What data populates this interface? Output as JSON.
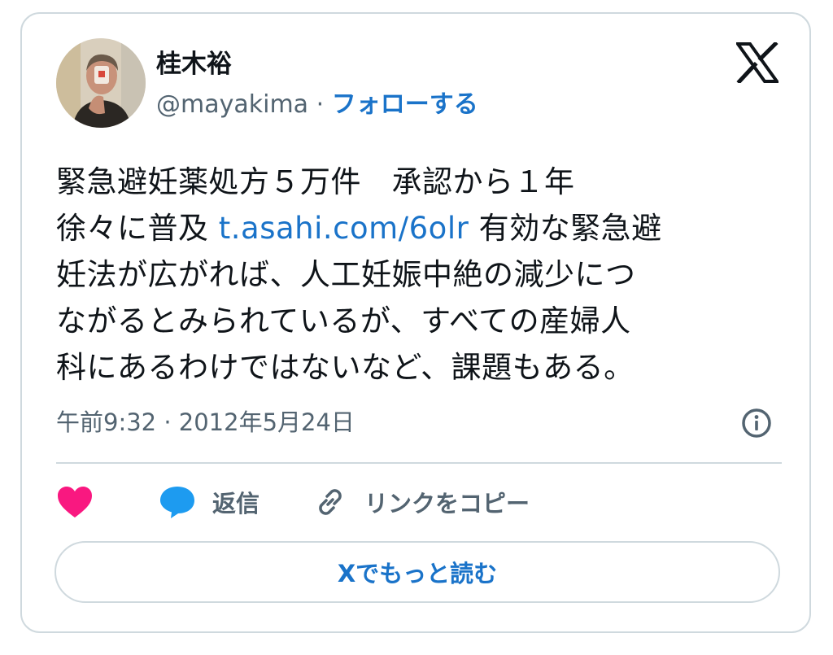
{
  "author": {
    "name": "桂木裕",
    "handle": "@mayakima",
    "separator": "·",
    "follow_label": "フォローする"
  },
  "tweet": {
    "line1": "緊急避妊薬処方５万件　承認から１年",
    "line2_before_link": "徐々に普及 ",
    "link": "t.asahi.com/6olr",
    "line2_after_link": " 有効な緊急避",
    "line3": "妊法が広がれば、人工妊娠中絶の減少につ",
    "line4": "ながるとみられているが、すべての産婦人",
    "line5": "科にあるわけではないなど、課題もある。"
  },
  "timestamp": "午前9:32 · 2012年5月24日",
  "actions": {
    "reply_label": "返信",
    "copy_link_label": "リンクをコピー"
  },
  "read_more_label": "Xでもっと読む",
  "icons": {
    "logo": "x-logo-icon",
    "info": "info-icon",
    "like": "heart-icon",
    "reply": "speech-bubble-icon",
    "copy": "link-icon"
  },
  "colors": {
    "accent": "#1a73c9",
    "heart": "#f91880",
    "reply_bubble": "#1d9bf0",
    "muted": "#536471",
    "border": "#cfd9de"
  }
}
